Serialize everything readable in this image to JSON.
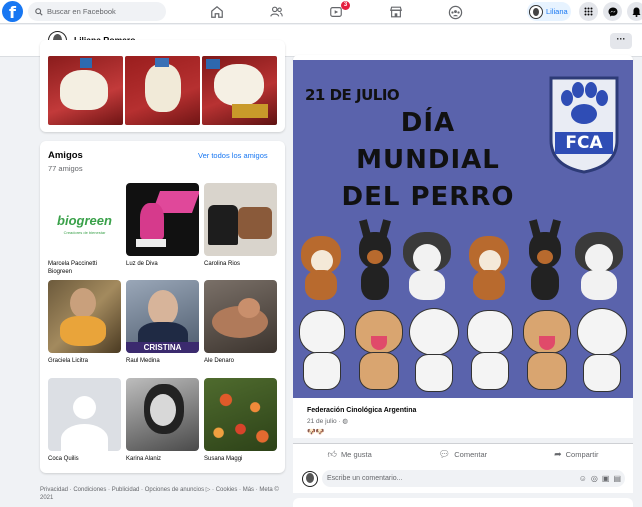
{
  "topbar": {
    "search_placeholder": "Buscar en Facebook",
    "notification_count": "3",
    "user_short": "Liliana"
  },
  "profile": {
    "name": "Liliana Romero",
    "more_label": "···"
  },
  "friends": {
    "title": "Amigos",
    "count": "77 amigos",
    "see_all": "Ver todos los amigos",
    "items": [
      {
        "name": "Marcela Paccinetti Biogreen",
        "logo_text": "biogreen",
        "logo_sub": "Creadores de bienestar"
      },
      {
        "name": "Luz de Diva"
      },
      {
        "name": "Carolina Rios"
      },
      {
        "name": "Graciela Licitra"
      },
      {
        "name": "Raul Medina",
        "overlay": "CRISTINA"
      },
      {
        "name": "Ale Denaro"
      },
      {
        "name": "Coca Quilis"
      },
      {
        "name": "Karina Alaniz"
      },
      {
        "name": "Susana Maggi"
      }
    ]
  },
  "footer": {
    "text": "Privacidad · Condiciones · Publicidad · Opciones de anuncios ▷ · Cookies · Más · Meta © 2021"
  },
  "post": {
    "image_date": "21 DE JULIO",
    "image_title_1": "DÍA",
    "image_title_2": "MUNDIAL",
    "image_title_3": "DEL PERRO",
    "image_logo": "FCA",
    "author": "Federación Cinológica Argentina",
    "date": "21 de julio · ",
    "emoji": "🐶🐶",
    "like": "Me gusta",
    "comment": "Comentar",
    "share": "Compartir",
    "comment_placeholder": "Escribe un comentario..."
  },
  "colors": {
    "brand": "#1877f2",
    "post_bg": "#5a63ac",
    "badge": "#e41e3f"
  }
}
